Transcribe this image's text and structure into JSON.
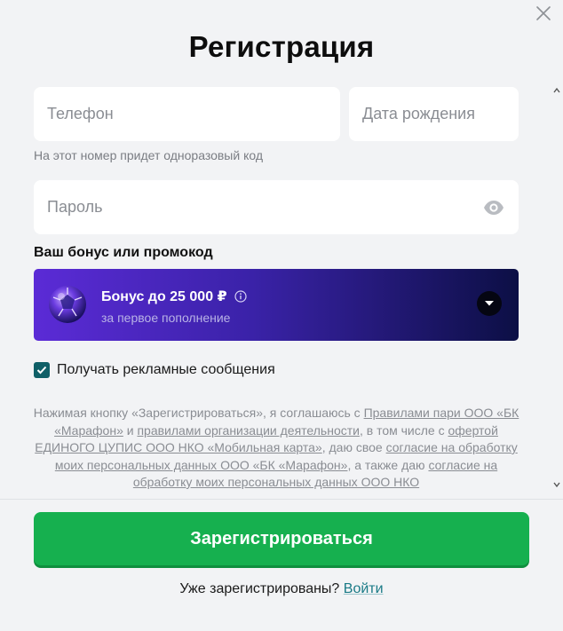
{
  "dialog": {
    "title": "Регистрация"
  },
  "form": {
    "phone_placeholder": "Телефон",
    "birthdate_placeholder": "Дата рождения",
    "phone_hint": "На этот номер придет одноразовый код",
    "password_placeholder": "Пароль"
  },
  "bonus": {
    "section_label": "Ваш бонус или промокод",
    "title": "Бонус до 25 000 ₽",
    "subtitle": "за первое пополнение"
  },
  "consent": {
    "checkbox_label": "Получать рекламные сообщения",
    "checked": true
  },
  "legal": {
    "part1": "Нажимая кнопку «Зарегистрироваться», я соглашаюсь с ",
    "link1": "Правилами пари ООО «БК «Марафон»",
    "part2": " и ",
    "link2": "правилами организации деятельности",
    "part3": ", в том числе с ",
    "link3": "офертой ЕДИНОГО ЦУПИС ООО НКО «Мобильная карта»",
    "part4": ", даю свое ",
    "link4": "согласие на обработку моих персональных данных ООО «БК «Марафон»",
    "part5": ", а также даю ",
    "link5": "согласие на обработку моих персональных данных ООО НКО"
  },
  "actions": {
    "register_label": "Зарегистрироваться",
    "already_registered": "Уже зарегистрированы?",
    "login_link": "Войти"
  },
  "colors": {
    "primary_button": "#16b04f",
    "checkbox": "#0f5f67",
    "link": "#1a7a86",
    "bonus_gradient_start": "#5b2bd6",
    "bonus_gradient_end": "#0c0f45"
  }
}
